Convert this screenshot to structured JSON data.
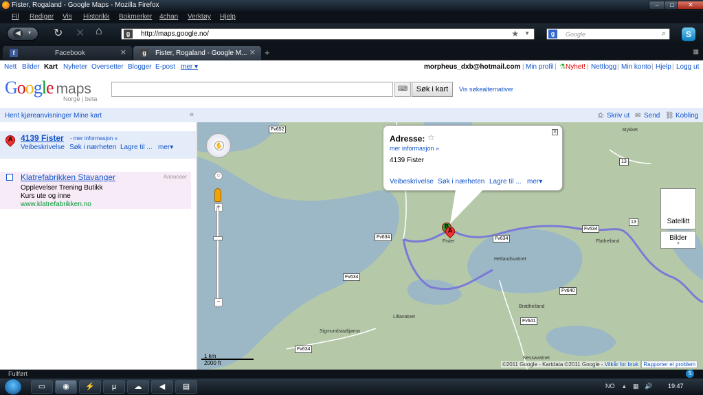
{
  "window": {
    "title": "Fister, Rogaland - Google Maps - Mozilla Firefox"
  },
  "menubar": [
    "Fil",
    "Rediger",
    "Vis",
    "Historikk",
    "Bokmerker",
    "4chan",
    "Verktøy",
    "Hjelp"
  ],
  "navbar": {
    "url": "http://maps.google.no/",
    "search_placeholder": "Google"
  },
  "tabs": [
    {
      "label": "Facebook",
      "favicon": "f"
    },
    {
      "label": "Fister, Rogaland - Google M...",
      "favicon": "g"
    }
  ],
  "gbar": {
    "links": [
      "Nett",
      "Bilder",
      "Kart",
      "Nyheter",
      "Oversetter",
      "Blogger",
      "E-post",
      "mer ▾"
    ],
    "user": "morpheus_dxb@hotmail.com",
    "right_links": [
      "Min profil",
      "Nyhet!",
      "Nettlogg",
      "Min konto",
      "Hjelp",
      "Logg ut"
    ]
  },
  "logo": {
    "google": "Google",
    "maps": "maps",
    "sub": "Norge | beta"
  },
  "search": {
    "button": "Søk i kart",
    "options": "Vis søkealternativer"
  },
  "toolbar": {
    "left": [
      "Hent kjøreanvisninger",
      "Mine kart"
    ],
    "collapse": "«",
    "right": [
      "Skriv ut",
      "Send",
      "Kobling"
    ]
  },
  "result": {
    "marker": "A",
    "title": "4139 Fister",
    "more": "- mer informasjon »",
    "links": [
      "Veibeskrivelse",
      "Søk i nærheten",
      "Lagre til ...",
      "mer▾"
    ]
  },
  "ad": {
    "title": "Klatrefabrikken Stavanger",
    "label": "Annonser",
    "line1": "Opplevelser Trening Butikk",
    "line2": "Kurs ute og inne",
    "url": "www.klatrefabrikken.no"
  },
  "bubble": {
    "heading": "Adresse:",
    "more": "mer informasjon »",
    "address": "4139 Fister",
    "links": [
      "Veibeskrivelse",
      "Søk i nærheten",
      "Lagre til ...",
      "mer▾"
    ]
  },
  "map": {
    "road_labels": [
      "Fv652",
      "Fv634",
      "Fv634",
      "Fv634",
      "Fv634",
      "Fv640",
      "Fv641",
      "Fv634",
      "13",
      "13"
    ],
    "place_labels": [
      "Stykket",
      "Fister",
      "Hetlandsvatnet",
      "Flatheiland",
      "Brattheiland",
      "Liltavatnet",
      "Sigmundstadtjørna",
      "Nessavatnet"
    ],
    "marker_a": "A",
    "marker_b": "B",
    "scale_km": "1 km",
    "scale_ft": "2000 ft",
    "copyright": "©2011 Google - Kartdata ©2011 Google -",
    "terms": "Vilkår for bruk",
    "report": "Rapporter et problem",
    "maptype_label": "Satellitt",
    "bilder_label": "Bilder"
  },
  "status": {
    "text": "Fullført"
  },
  "taskbar": {
    "lang": "NO",
    "clock": "19:47"
  },
  "colors": {
    "link": "#1155cc",
    "map_land": "#b5c9a8",
    "map_water": "#9cb8c6",
    "route": "#7a7ad6"
  }
}
